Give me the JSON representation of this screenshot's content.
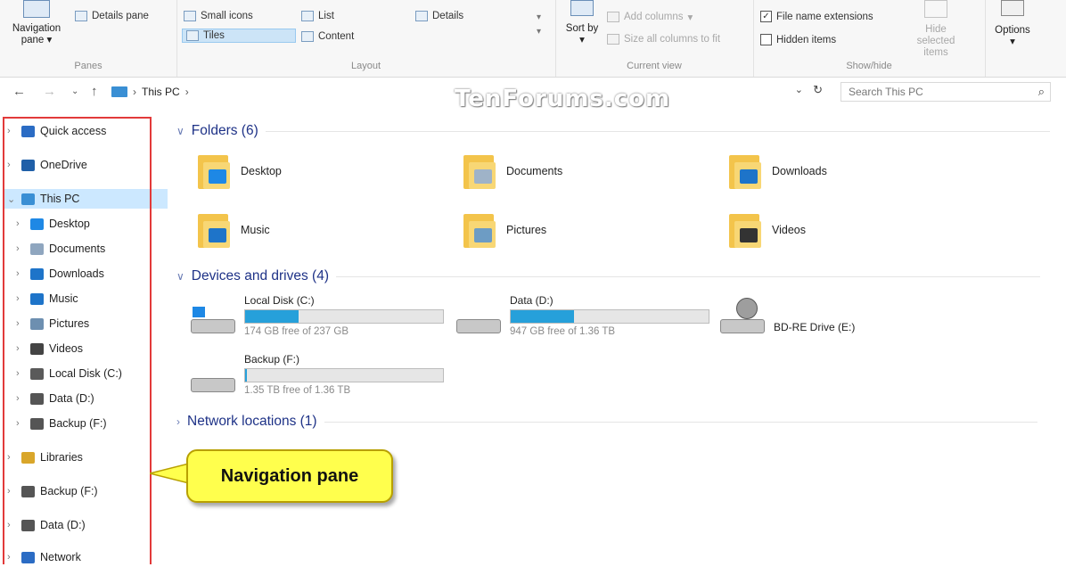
{
  "ribbon": {
    "panes": {
      "navigation_pane_label": "Navigation pane",
      "details_pane_label": "Details pane",
      "group_label": "Panes"
    },
    "layout": {
      "small_icons": "Small icons",
      "list": "List",
      "details": "Details",
      "tiles": "Tiles",
      "content": "Content",
      "group_label": "Layout"
    },
    "current_view": {
      "sort_by": "Sort by",
      "add_columns": "Add columns",
      "size_all_columns": "Size all columns to fit",
      "group_label": "Current view"
    },
    "show_hide": {
      "file_name_extensions": "File name extensions",
      "hidden_items": "Hidden items",
      "hide_selected_items": "Hide selected items",
      "group_label": "Show/hide"
    },
    "options_label": "Options"
  },
  "address": {
    "path": "This PC",
    "search_placeholder": "Search This PC"
  },
  "watermark": "TenForums.com",
  "nav_pane": {
    "items": [
      {
        "label": "Quick access",
        "icon": "star-icon",
        "color": "#2b6cc4"
      },
      {
        "label": "OneDrive",
        "icon": "cloud-icon",
        "color": "#1f5fa8"
      },
      {
        "label": "This PC",
        "icon": "computer-icon",
        "color": "#3a8fd4"
      },
      {
        "label": "Desktop",
        "icon": "desktop-icon",
        "color": "#1e88e5"
      },
      {
        "label": "Documents",
        "icon": "documents-icon",
        "color": "#8fa6bf"
      },
      {
        "label": "Downloads",
        "icon": "downloads-icon",
        "color": "#1e74c9"
      },
      {
        "label": "Music",
        "icon": "music-icon",
        "color": "#1e74c9"
      },
      {
        "label": "Pictures",
        "icon": "pictures-icon",
        "color": "#6d8fb0"
      },
      {
        "label": "Videos",
        "icon": "videos-icon",
        "color": "#444444"
      },
      {
        "label": "Local Disk (C:)",
        "icon": "local-disk-icon",
        "color": "#5a5a5a"
      },
      {
        "label": "Data (D:)",
        "icon": "drive-icon",
        "color": "#555555"
      },
      {
        "label": "Backup (F:)",
        "icon": "drive-icon",
        "color": "#555555"
      },
      {
        "label": "Libraries",
        "icon": "libraries-icon",
        "color": "#d9a62a"
      },
      {
        "label": "Backup (F:)",
        "icon": "drive-icon",
        "color": "#555555"
      },
      {
        "label": "Data (D:)",
        "icon": "drive-icon",
        "color": "#555555"
      },
      {
        "label": "Network",
        "icon": "network-icon",
        "color": "#2b6cc4"
      }
    ]
  },
  "content": {
    "folders_header": "Folders (6)",
    "folders": [
      {
        "label": "Desktop",
        "overlay": "#1e88e5"
      },
      {
        "label": "Documents",
        "overlay": "#9fb3c8"
      },
      {
        "label": "Downloads",
        "overlay": "#1e74c9"
      },
      {
        "label": "Music",
        "overlay": "#1e74c9"
      },
      {
        "label": "Pictures",
        "overlay": "#6d9cc4"
      },
      {
        "label": "Videos",
        "overlay": "#333333"
      }
    ],
    "devices_header": "Devices and drives (4)",
    "drives": [
      {
        "label": "Local Disk (C:)",
        "free": "174 GB free of 237 GB",
        "used_fraction": 0.27
      },
      {
        "label": "Data (D:)",
        "free": "947 GB free of 1.36 TB",
        "used_fraction": 0.32
      },
      {
        "label": "BD-RE Drive (E:)"
      },
      {
        "label": "Backup (F:)",
        "free": "1.35 TB free of 1.36 TB",
        "used_fraction": 0.01
      }
    ],
    "network_header": "Network locations (1)"
  },
  "callout": {
    "text": "Navigation pane",
    "color": "#ffff4d"
  },
  "highlight_color": "#e23a3a"
}
